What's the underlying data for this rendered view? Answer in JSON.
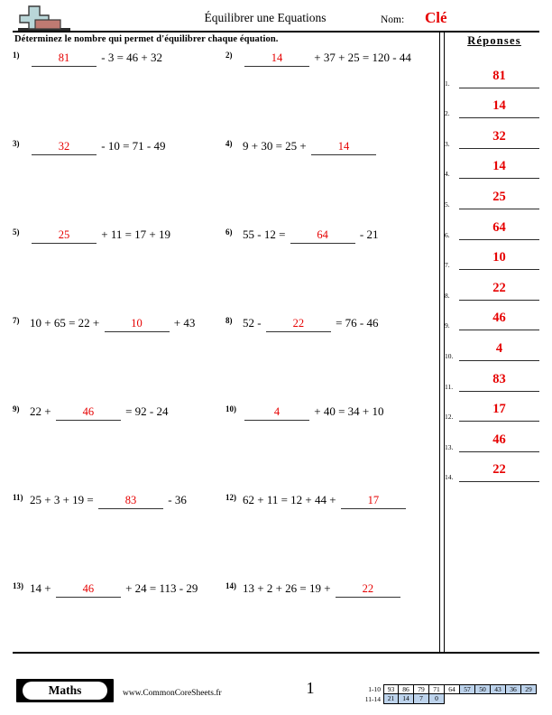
{
  "header": {
    "title": "Équilibrer une Equations",
    "name_label": "Nom:",
    "name_value": "Clé",
    "logo_icon": "plus-block-icon"
  },
  "instruction": "Déterminez le nombre qui permet d'équilibrer chaque équation.",
  "answers": {
    "title": "Réponses",
    "items": [
      {
        "index": "1.",
        "value": "81"
      },
      {
        "index": "2.",
        "value": "14"
      },
      {
        "index": "3.",
        "value": "32"
      },
      {
        "index": "4.",
        "value": "14"
      },
      {
        "index": "5.",
        "value": "25"
      },
      {
        "index": "6.",
        "value": "64"
      },
      {
        "index": "7.",
        "value": "10"
      },
      {
        "index": "8.",
        "value": "22"
      },
      {
        "index": "9.",
        "value": "46"
      },
      {
        "index": "10.",
        "value": "4"
      },
      {
        "index": "11.",
        "value": "83"
      },
      {
        "index": "12.",
        "value": "17"
      },
      {
        "index": "13.",
        "value": "46"
      },
      {
        "index": "14.",
        "value": "22"
      }
    ]
  },
  "questions": [
    {
      "num": "1)",
      "pre": "",
      "answer": "81",
      "post": " - 3 = 46 + 32"
    },
    {
      "num": "2)",
      "pre": "",
      "answer": "14",
      "post": " + 37 + 25 = 120 - 44"
    },
    {
      "num": "3)",
      "pre": "",
      "answer": "32",
      "post": " - 10 = 71 - 49"
    },
    {
      "num": "4)",
      "pre": "9 + 30 = 25 + ",
      "answer": "14",
      "post": ""
    },
    {
      "num": "5)",
      "pre": "",
      "answer": "25",
      "post": " + 11 = 17 + 19"
    },
    {
      "num": "6)",
      "pre": "55 - 12 = ",
      "answer": "64",
      "post": " - 21"
    },
    {
      "num": "7)",
      "pre": "10 + 65 = 22 + ",
      "answer": "10",
      "post": " + 43"
    },
    {
      "num": "8)",
      "pre": "52 - ",
      "answer": "22",
      "post": " = 76 - 46"
    },
    {
      "num": "9)",
      "pre": "22 + ",
      "answer": "46",
      "post": " = 92 - 24"
    },
    {
      "num": "10)",
      "pre": "",
      "answer": "4",
      "post": " + 40 = 34 + 10"
    },
    {
      "num": "11)",
      "pre": "25 + 3 + 19 = ",
      "answer": "83",
      "post": " - 36"
    },
    {
      "num": "12)",
      "pre": "62 + 11 = 12 + 44 + ",
      "answer": "17",
      "post": ""
    },
    {
      "num": "13)",
      "pre": "14 + ",
      "answer": "46",
      "post": " + 24 = 113 - 29"
    },
    {
      "num": "14)",
      "pre": "13 + 2 + 26 = 19 + ",
      "answer": "22",
      "post": ""
    }
  ],
  "footer": {
    "brand": "Maths",
    "site": "www.CommonCoreSheets.fr",
    "page_number": "1",
    "score_table": {
      "row1_label": "1-10",
      "row2_label": "11-14",
      "row1": [
        {
          "value": "93",
          "shaded": false
        },
        {
          "value": "86",
          "shaded": false
        },
        {
          "value": "79",
          "shaded": false
        },
        {
          "value": "71",
          "shaded": false
        },
        {
          "value": "64",
          "shaded": false
        },
        {
          "value": "57",
          "shaded": true
        },
        {
          "value": "50",
          "shaded": true
        },
        {
          "value": "43",
          "shaded": true
        },
        {
          "value": "36",
          "shaded": true
        },
        {
          "value": "29",
          "shaded": true
        }
      ],
      "row2": [
        {
          "value": "21",
          "shaded": true
        },
        {
          "value": "14",
          "shaded": true
        },
        {
          "value": "7",
          "shaded": true
        },
        {
          "value": "0",
          "shaded": true
        }
      ]
    }
  },
  "colors": {
    "answer_red": "#e60000",
    "score_shade": "#bdd3ec",
    "logo_plus": "#b9d6d8",
    "logo_block": "#bf7a72"
  }
}
